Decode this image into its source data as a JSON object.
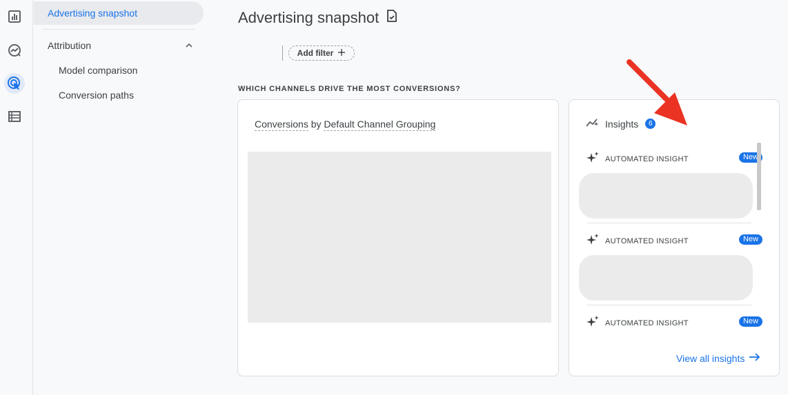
{
  "rail": {
    "icons": [
      "reports-icon",
      "explore-icon",
      "advertising-icon",
      "configure-icon"
    ]
  },
  "nav": {
    "active_item": "Advertising snapshot",
    "section_label": "Attribution",
    "sub_items": [
      "Model comparison",
      "Conversion paths"
    ]
  },
  "page": {
    "title": "Advertising snapshot",
    "add_filter_label": "Add filter",
    "section_heading": "WHICH CHANNELS DRIVE THE MOST CONVERSIONS?"
  },
  "chart_card": {
    "metric": "Conversions",
    "connector": "by",
    "dimension": "Default Channel Grouping"
  },
  "insights": {
    "title": "Insights",
    "count": "6",
    "items": [
      {
        "label": "AUTOMATED INSIGHT",
        "badge": "New"
      },
      {
        "label": "AUTOMATED INSIGHT",
        "badge": "New"
      },
      {
        "label": "AUTOMATED INSIGHT",
        "badge": "New"
      }
    ],
    "view_all_label": "View all insights"
  },
  "colors": {
    "accent": "#1a73e8",
    "annotation_arrow": "#ea3323",
    "placeholder": "#ebebeb"
  }
}
